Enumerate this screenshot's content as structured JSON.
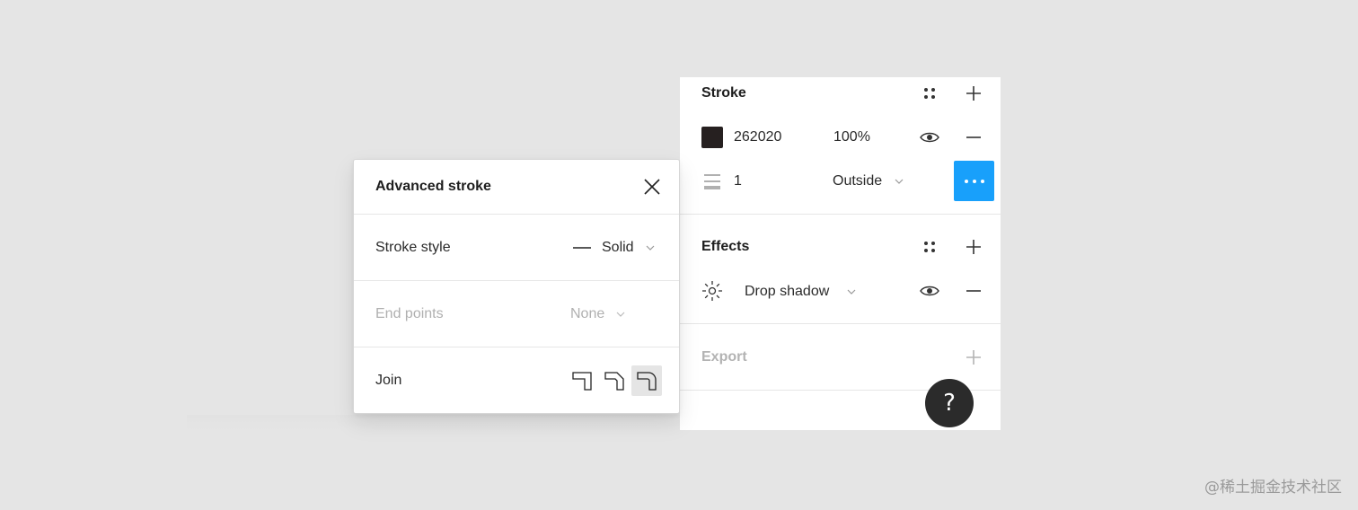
{
  "stroke": {
    "title": "Stroke",
    "color_hex": "262020",
    "swatch_color": "#262020",
    "opacity": "100%",
    "weight": "1",
    "position": "Outside"
  },
  "effects": {
    "title": "Effects",
    "effect_name": "Drop shadow"
  },
  "export": {
    "title": "Export"
  },
  "help": {
    "label": "?"
  },
  "advanced_stroke": {
    "title": "Advanced stroke",
    "stroke_style_label": "Stroke style",
    "stroke_style_value": "Solid",
    "end_points_label": "End points",
    "end_points_value": "None",
    "join_label": "Join",
    "join_options": [
      "miter",
      "bevel",
      "round"
    ],
    "join_selected": "round"
  },
  "colors": {
    "accent": "#18a0fb",
    "panel_bg": "#ffffff",
    "canvas_bg": "#e5e5e5"
  },
  "watermark": "@稀土掘金技术社区"
}
